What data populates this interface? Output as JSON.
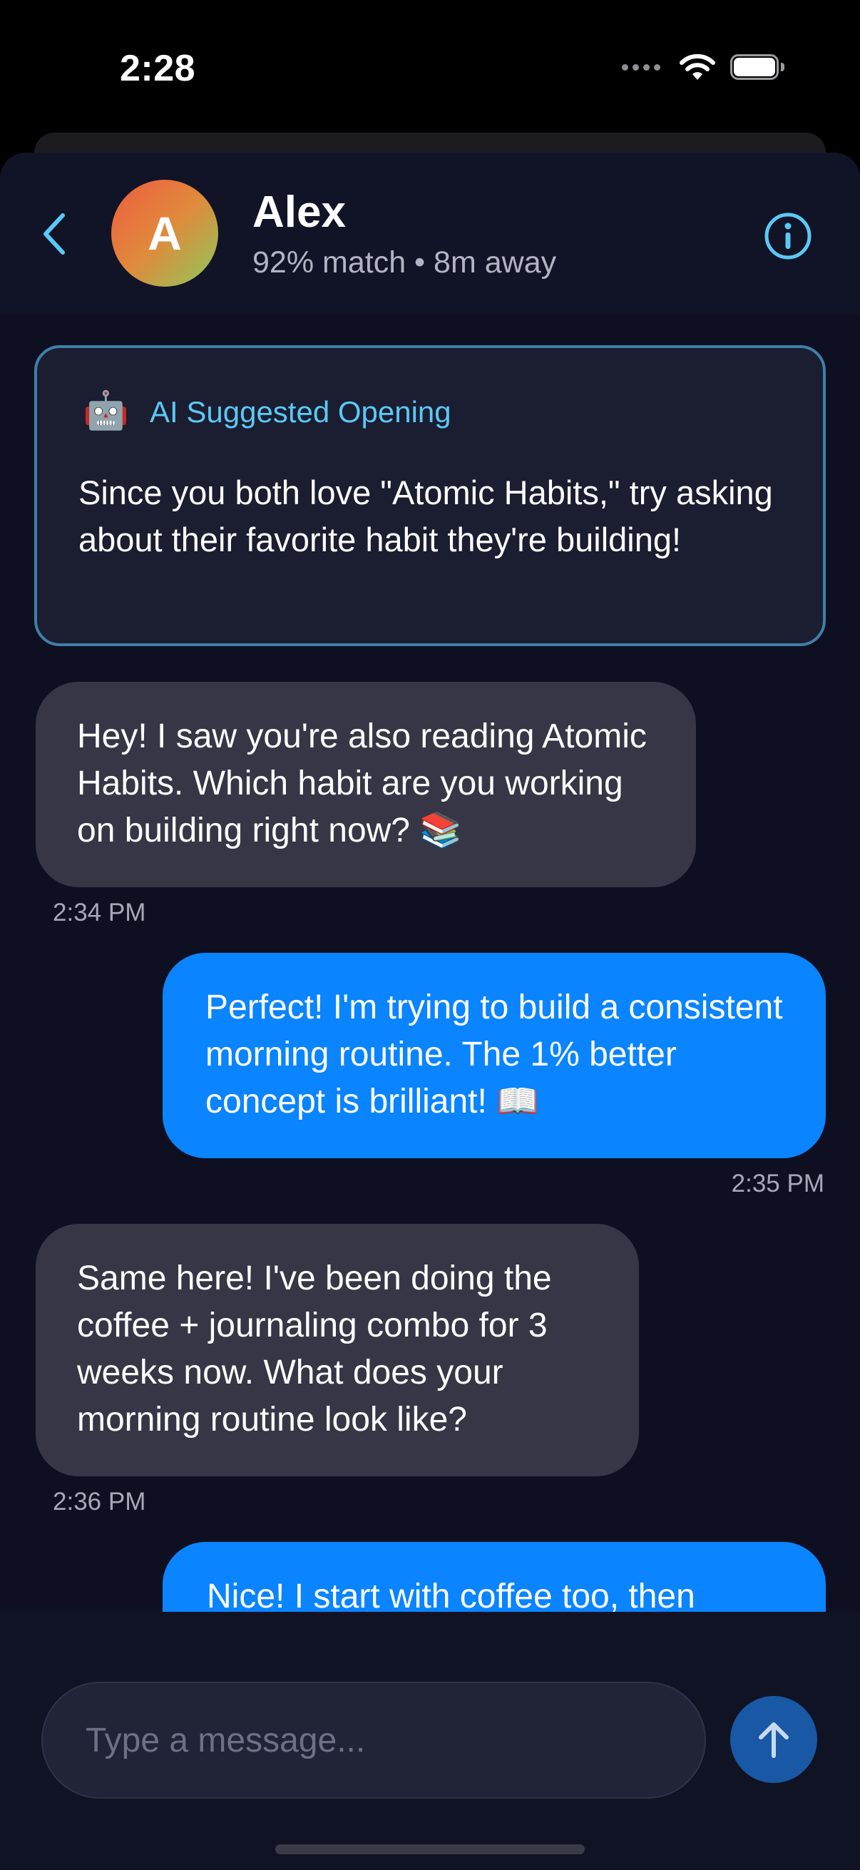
{
  "status_bar": {
    "time": "2:28"
  },
  "header": {
    "avatar_initial": "A",
    "name": "Alex",
    "meta": "92% match • 8m away"
  },
  "ai_suggestion": {
    "icon": "robot-icon",
    "emoji": "🤖",
    "title": "AI Suggested Opening",
    "text": "Since you both love \"Atomic Habits,\" try asking about their favorite habit they're building!"
  },
  "messages": [
    {
      "direction": "incoming",
      "text": "Hey! I saw you're also reading Atomic Habits. Which habit are you working on building right now? 📚",
      "time": "2:34 PM"
    },
    {
      "direction": "outgoing",
      "text": "Perfect! I'm trying to build a consistent morning routine. The 1% better concept is brilliant! 📖",
      "time": "2:35 PM"
    },
    {
      "direction": "incoming",
      "text": "Same here! I've been doing the coffee + journaling combo for 3 weeks now. What does your morning routine look like?",
      "time": "2:36 PM"
    },
    {
      "direction": "outgoing",
      "text": "Nice! I start with coffee too, then"
    }
  ],
  "composer": {
    "placeholder": "Type a message..."
  },
  "colors": {
    "background": "#0e1022",
    "accent": "#0a84ff",
    "ai_accent": "#5cc8f5",
    "incoming_bubble": "#363647"
  }
}
